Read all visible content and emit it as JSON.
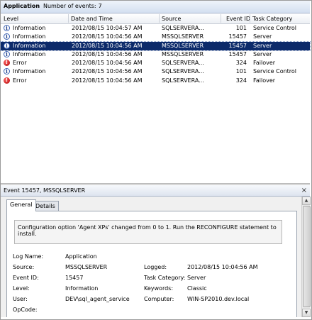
{
  "header": {
    "title": "Application",
    "count_label": "Number of events:",
    "count_value": "7"
  },
  "columns": {
    "level": "Level",
    "date": "Date and Time",
    "source": "Source",
    "event_id": "Event ID",
    "category": "Task Category"
  },
  "rows": [
    {
      "icon": "info-icon",
      "level": "Information",
      "date": "2012/08/15 10:04:57 AM",
      "source": "SQLSERVERA...",
      "event_id": "101",
      "category": "Service Control"
    },
    {
      "icon": "info-icon",
      "level": "Information",
      "date": "2012/08/15 10:04:56 AM",
      "source": "MSSQLSERVER",
      "event_id": "15457",
      "category": "Server"
    },
    {
      "icon": "info-icon",
      "level": "Information",
      "date": "2012/08/15 10:04:56 AM",
      "source": "MSSQLSERVER",
      "event_id": "15457",
      "category": "Server"
    },
    {
      "icon": "info-icon",
      "level": "Information",
      "date": "2012/08/15 10:04:56 AM",
      "source": "MSSQLSERVER",
      "event_id": "15457",
      "category": "Server"
    },
    {
      "icon": "error-icon",
      "level": "Error",
      "date": "2012/08/15 10:04:56 AM",
      "source": "SQLSERVERA...",
      "event_id": "324",
      "category": "Failover"
    },
    {
      "icon": "info-icon",
      "level": "Information",
      "date": "2012/08/15 10:04:56 AM",
      "source": "SQLSERVERA...",
      "event_id": "101",
      "category": "Service Control"
    },
    {
      "icon": "error-icon",
      "level": "Error",
      "date": "2012/08/15 10:04:56 AM",
      "source": "SQLSERVERA...",
      "event_id": "324",
      "category": "Failover"
    }
  ],
  "selected_row": 2,
  "detail": {
    "title": "Event 15457, MSSQLSERVER",
    "close_glyph": "×",
    "tabs": [
      "General",
      "Details"
    ],
    "message": "Configuration option 'Agent XPs' changed from 0 to 1. Run the RECONFIGURE statement to install.",
    "fields": {
      "log_name_label": "Log Name:",
      "log_name": "Application",
      "source_label": "Source:",
      "source": "MSSQLSERVER",
      "event_id_label": "Event ID:",
      "event_id": "15457",
      "level_label": "Level:",
      "level": "Information",
      "user_label": "User:",
      "user": "DEV\\sql_agent_service",
      "opcode_label": "OpCode:",
      "logged_label": "Logged:",
      "logged": "2012/08/15 10:04:56 AM",
      "task_category_label": "Task Category:",
      "task_category": "Server",
      "keywords_label": "Keywords:",
      "keywords": "Classic",
      "computer_label": "Computer:",
      "computer": "WIN-SP2010.dev.local"
    }
  },
  "colors": {
    "selection": "#0c2a6a",
    "error": "#c00000",
    "info": "#3a61b3"
  }
}
